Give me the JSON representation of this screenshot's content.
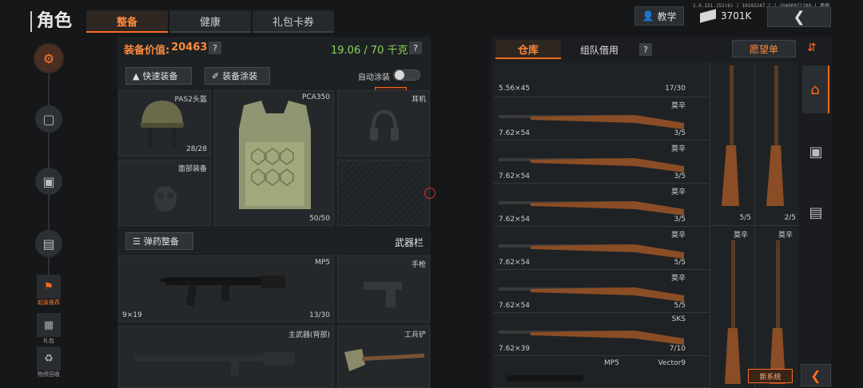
{
  "header": {
    "title": "角色",
    "tabs": [
      {
        "label": "整备",
        "active": true
      },
      {
        "label": "健康",
        "active": false
      },
      {
        "label": "礼包卡券",
        "active": false
      }
    ],
    "tutorial_label": "教学",
    "currency": "3701K",
    "version": "1.0.151.151(6) | 10192247.1 | 10400071188 | 离婚"
  },
  "left_rail": {
    "small_items": [
      {
        "label": "起装推荐",
        "icon": "figure-icon",
        "accent": true
      },
      {
        "label": "礼包",
        "icon": "gift-icon",
        "accent": false
      },
      {
        "label": "物资回收",
        "icon": "recycle-icon",
        "accent": false
      }
    ]
  },
  "equipment": {
    "value_label": "装备价值:",
    "value": "20463",
    "weight": "19.06 / 70 千克",
    "quick_equip": "快速装备",
    "equip_paint": "装备涂装",
    "auto_paint": "自动涂装",
    "new_badge": "新系统",
    "helmet": {
      "name": "PAS2头盔",
      "durability": "28/28"
    },
    "armor": {
      "name": "PCA350",
      "durability": "50/50"
    },
    "earphone": {
      "name": "耳机"
    },
    "face": {
      "name": "面部装备"
    },
    "ammo_btn": "弹药整备",
    "weapon_bar": "武器栏",
    "primary": {
      "name": "MP5",
      "caliber": "9×19",
      "ammo": "13/30"
    },
    "pistol": {
      "name": "手枪"
    },
    "back_weapon": {
      "name": "主武器(背部)"
    },
    "melee": {
      "name": "工兵铲"
    }
  },
  "warehouse": {
    "tabs": [
      {
        "label": "仓库",
        "active": true
      },
      {
        "label": "组队借用",
        "active": false
      }
    ],
    "wishlist": "愿望单",
    "top_row": {
      "caliber": "5.56×45",
      "count": "17/30"
    },
    "rows": [
      {
        "name": "莫辛",
        "caliber": "7.62×54",
        "count": "3/5"
      },
      {
        "name": "莫辛",
        "caliber": "7.62×54",
        "count": "3/5"
      },
      {
        "name": "莫辛",
        "caliber": "7.62×54",
        "count": "3/5"
      },
      {
        "name": "莫辛",
        "caliber": "7.62×54",
        "count": "5/5"
      },
      {
        "name": "莫辛",
        "caliber": "7.62×54",
        "count": "5/5"
      },
      {
        "name": "SKS",
        "caliber": "7.62×39",
        "count": "7/10"
      }
    ],
    "bottom_row": {
      "name1": "MP5",
      "name2": "Vector9"
    },
    "vertical": [
      {
        "count": "5/5"
      },
      {
        "count": "2/5"
      },
      {
        "name": "莫辛"
      },
      {
        "name": "莫辛"
      }
    ],
    "new_badge": "新系统"
  },
  "colors": {
    "accent": "#ff6a1e",
    "value": "#ff8a3c",
    "weight": "#8fd35a"
  }
}
